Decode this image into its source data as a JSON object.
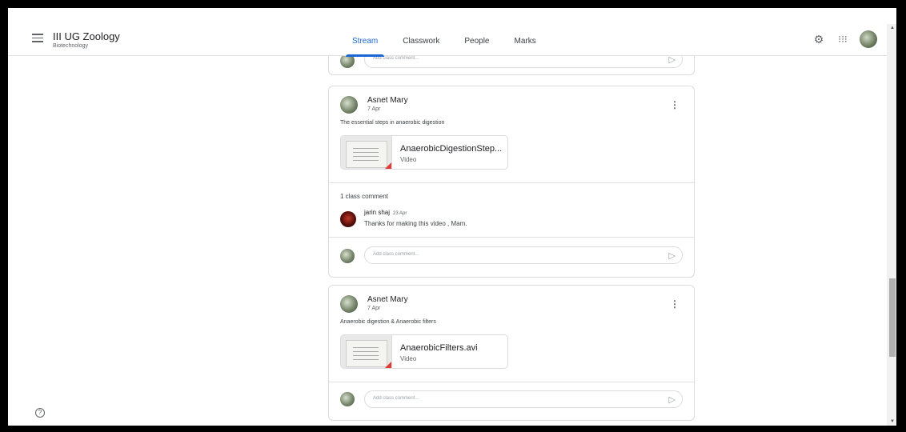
{
  "header": {
    "class_title": "III UG Zoology",
    "class_section": "Biotechnology",
    "tabs": [
      {
        "label": "Stream",
        "active": true
      },
      {
        "label": "Classwork",
        "active": false
      },
      {
        "label": "People",
        "active": false
      },
      {
        "label": "Marks",
        "active": false
      }
    ],
    "icons": [
      "menu-icon",
      "gear-icon",
      "apps-grid-icon",
      "account-avatar"
    ]
  },
  "comment_placeholder": "Add class comment...",
  "posts": [
    {
      "author": "Asnet Mary",
      "date": "7 Apr",
      "description": "The essential steps in anaerobic digestion",
      "attachment": {
        "title": "AnaerobicDigestionStep...",
        "type": "Video"
      },
      "comment_count_label": "1 class comment",
      "comments": [
        {
          "author": "jarin shaj",
          "date": "23 Apr",
          "text": "Thanks for making this video , Mam."
        }
      ]
    },
    {
      "author": "Asnet Mary",
      "date": "7 Apr",
      "description": "Anaerobic digestion & Anaerobic filters",
      "attachment": {
        "title": "AnaerobicFilters.avi",
        "type": "Video"
      }
    }
  ],
  "colors": {
    "accent": "#1967d2",
    "border": "#dadce0"
  }
}
